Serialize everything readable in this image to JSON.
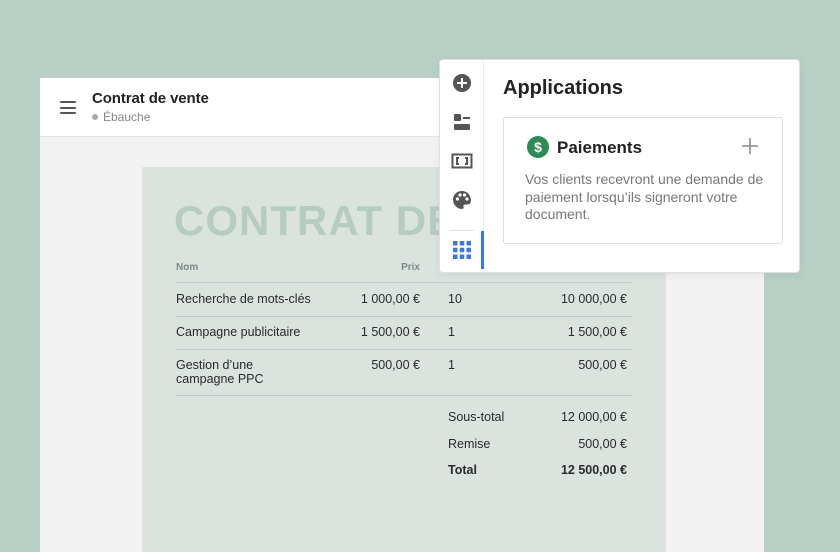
{
  "editor": {
    "title": "Contrat de vente",
    "status": "Ébauche"
  },
  "document": {
    "heading": "CONTRAT DE",
    "columns": {
      "name": "Nom",
      "price": "Prix"
    },
    "rows": [
      {
        "name": "Recherche de mots-clés",
        "price": "1 000,00 €",
        "qty": "10",
        "total": "10 000,00 €"
      },
      {
        "name": "Campagne publicitaire",
        "price": "1 500,00 €",
        "qty": "1",
        "total": "1 500,00 €"
      },
      {
        "name_line1": "Gestion d’une",
        "name_line2": "campagne PPC",
        "price": "500,00 €",
        "qty": "1",
        "total": "500,00 €"
      }
    ],
    "summary": {
      "subtotal_label": "Sous-total",
      "subtotal_value": "12 000,00 €",
      "discount_label": "Remise",
      "discount_value": "500,00 €",
      "total_label": "Total",
      "total_value": "12 500,00 €"
    }
  },
  "panel": {
    "title": "Applications",
    "rail_icons": [
      "add-circle-icon",
      "blocks-icon",
      "fields-icon",
      "palette-icon",
      "apps-grid-icon"
    ],
    "active_rail": "apps-grid-icon",
    "app": {
      "icon_glyph": "$",
      "name": "Paiements",
      "description": "Vos clients recevront une demande de paiement lorsqu’ils signeront votre document."
    }
  },
  "colors": {
    "background": "#b8cfc6",
    "paper": "#dbe3df",
    "heading_watermark": "#b6ccc2",
    "accent_blue": "#3d78d8",
    "payment_green": "#2e8b57"
  }
}
